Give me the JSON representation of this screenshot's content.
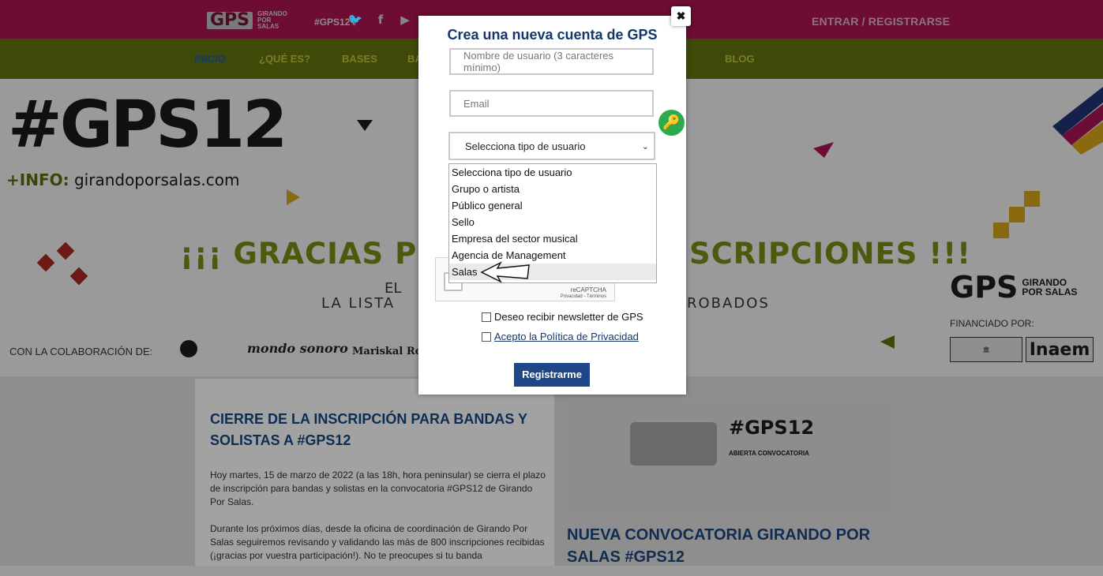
{
  "header": {
    "logo_text": "GPS",
    "logo_sub": "GIRANDO POR SALAS",
    "hashtag": "#GPS12",
    "social": [
      "twitter-icon",
      "facebook-icon",
      "youtube-icon"
    ],
    "login": "ENTRAR / REGISTRARSE"
  },
  "nav": {
    "items": [
      "INICIO",
      "¿QUÉ ES?",
      "BASES",
      "BA",
      "BLOG"
    ]
  },
  "hero": {
    "gps_big": "#GPS12",
    "info_prefix": "+INFO:",
    "info_site": "girandoporsalas.com",
    "gracias_left": "¡¡¡ GRACIAS PO",
    "gracias_right": "SCRIPCIONES !!!",
    "el": "EL",
    "lista": "LA LISTA",
    "aprobados": "ROBADOS",
    "con_colab": "CON LA COLABORACIÓN DE:",
    "partner_mondo": "mondo sonoro",
    "partner_mariskal": "Mariskal Rock",
    "right_logo": "GPS",
    "right_logo_sub": "GIRANDO POR SALAS",
    "financiado": "FINANCIADO POR:",
    "inaem": "Inaem"
  },
  "news": {
    "left_title": "CIERRE DE LA INSCRIPCIÓN PARA BANDAS Y SOLISTAS A #GPS12",
    "p1": "Hoy martes, 15 de marzo de 2022 (a las 18h, hora peninsular) se cierra el plazo de inscripción para bandas y solistas en la convocatoria #GPS12 de Girando Por Salas.",
    "p2": "Durante los próximos días, desde la oficina de coordinación de Girando Por Salas seguiremos revisando y validando las más de 800 inscripciones recibidas (¡gracias por vuestra participación!). No te preocupes si tu banda",
    "promo_title": "#GPS12",
    "promo_sub": "ABIERTA CONVOCATORIA",
    "right_title": "NUEVA CONVOCATORIA GIRANDO POR SALAS #GPS12"
  },
  "modal": {
    "title": "Crea una nueva cuenta de GPS",
    "close": "✖",
    "username_placeholder": "Nombre de usuario (3 caracteres mínimo)",
    "email_placeholder": "Email",
    "select_value": "Selecciona tipo de usuario",
    "options": [
      "Selecciona tipo de usuario",
      "Grupo o artista",
      "Público general",
      "Sello",
      "Empresa del sector musical",
      "Agencia de Management",
      "Salas"
    ],
    "hovered_option": "Salas",
    "recaptcha": "reCAPTCHA",
    "recaptcha_links": "Privacidad - Términos",
    "newsletter": "Deseo recibir newsletter de GPS",
    "privacy": "Acepto la Política de Privacidad",
    "submit": "Registrarme"
  }
}
